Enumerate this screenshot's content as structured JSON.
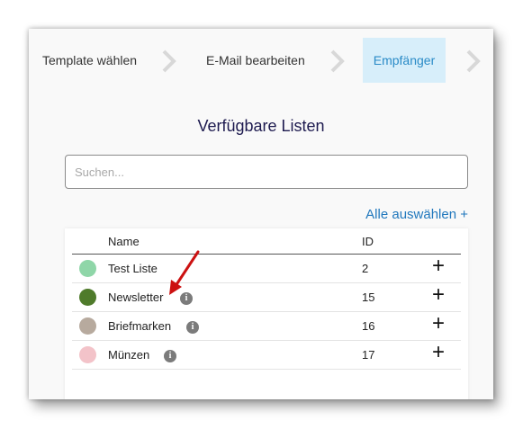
{
  "wizard": {
    "steps": [
      {
        "label": "Template wählen"
      },
      {
        "label": "E-Mail bearbeiten"
      },
      {
        "label": "Empfänger"
      }
    ]
  },
  "main": {
    "title": "Verfügbare Listen",
    "search": {
      "placeholder": "Suchen...",
      "value": ""
    },
    "select_all_label": "Alle auswählen +"
  },
  "table": {
    "headers": {
      "name": "Name",
      "id": "ID"
    },
    "rows": [
      {
        "name": "Test Liste",
        "id": "2",
        "color": "#8fd6a8",
        "info": false
      },
      {
        "name": "Newsletter",
        "id": "15",
        "color": "#4f7b2b",
        "info": true
      },
      {
        "name": "Briefmarken",
        "id": "16",
        "color": "#b7aa9e",
        "info": true
      },
      {
        "name": "Münzen",
        "id": "17",
        "color": "#f3c3c9",
        "info": true
      }
    ],
    "add_symbol": "+",
    "info_symbol": "i"
  },
  "annotation": {
    "arrow_color": "#cc1111"
  }
}
